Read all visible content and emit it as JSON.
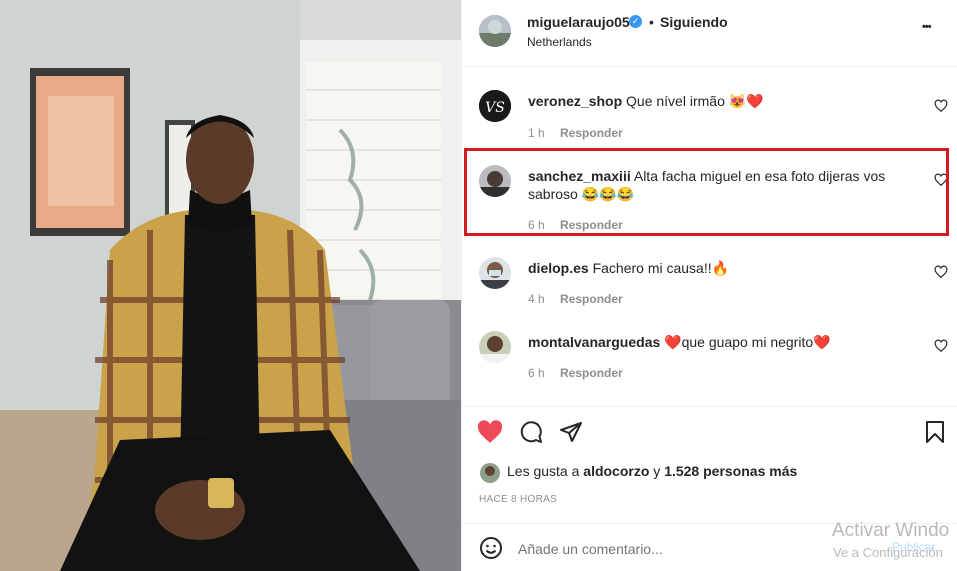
{
  "header": {
    "username": "miguelaraujo05",
    "dot": "•",
    "follow_status": "Siguiendo",
    "location": "Netherlands",
    "more_label": "•••"
  },
  "comments": [
    {
      "username": "veronez_shop",
      "text": "Que nível irmão 😻❤️",
      "time": "1 h",
      "reply": "Responder"
    },
    {
      "username": "sanchez_maxiii",
      "text": "Alta facha miguel en esa foto dijeras vos sabroso 😂😂😂",
      "time": "6 h",
      "reply": "Responder"
    },
    {
      "username": "dielop.es",
      "text": "Fachero mi causa!!🔥",
      "time": "4 h",
      "reply": "Responder"
    },
    {
      "username": "montalvanarguedas",
      "text": "❤️que guapo mi negrito❤️",
      "time": "6 h",
      "reply": "Responder"
    }
  ],
  "likes": {
    "prefix": "Les gusta a",
    "user": "aldocorzo",
    "connector": "y",
    "others": "1.528 personas más"
  },
  "timestamp": "HACE 8 HORAS",
  "add_comment": {
    "placeholder": "Añade un comentario...",
    "publish": "Publicar"
  },
  "watermark": {
    "line1": "Activar Windo",
    "line2": "Ve a Configuración"
  },
  "colors": {
    "accent_red": "#ed4956",
    "highlight_box": "#d71920",
    "verified_blue": "#3897f0",
    "publish_blue": "#b2dffc"
  }
}
